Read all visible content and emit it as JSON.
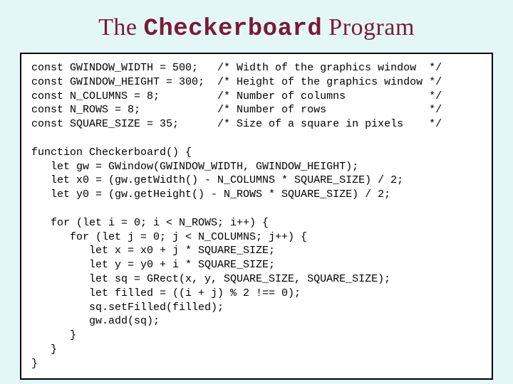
{
  "title_pre": "The ",
  "title_mono": "Checkerboard",
  "title_post": " Program",
  "code": "const GWINDOW_WIDTH = 500;   /* Width of the graphics window  */\nconst GWINDOW_HEIGHT = 300;  /* Height of the graphics window */\nconst N_COLUMNS = 8;         /* Number of columns             */\nconst N_ROWS = 8;            /* Number of rows                */\nconst SQUARE_SIZE = 35;      /* Size of a square in pixels    */\n\nfunction Checkerboard() {\n   let gw = GWindow(GWINDOW_WIDTH, GWINDOW_HEIGHT);\n   let x0 = (gw.getWidth() - N_COLUMNS * SQUARE_SIZE) / 2;\n   let y0 = (gw.getHeight() - N_ROWS * SQUARE_SIZE) / 2;\n\n   for (let i = 0; i < N_ROWS; i++) {\n      for (let j = 0; j < N_COLUMNS; j++) {\n         let x = x0 + j * SQUARE_SIZE;\n         let y = y0 + i * SQUARE_SIZE;\n         let sq = GRect(x, y, SQUARE_SIZE, SQUARE_SIZE);\n         let filled = ((i + j) % 2 !== 0);\n         sq.setFilled(filled);\n         gw.add(sq);\n      }\n   }\n}"
}
